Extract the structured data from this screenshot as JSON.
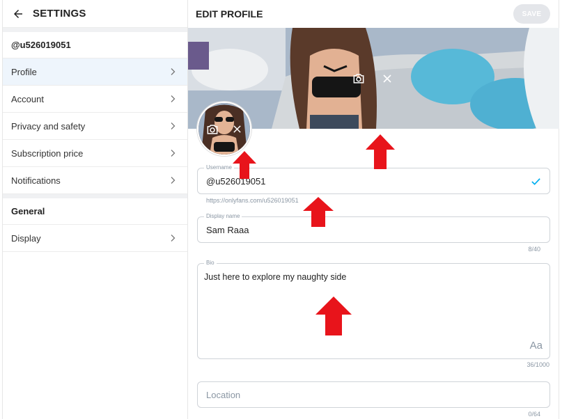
{
  "sidebar": {
    "title": "SETTINGS",
    "username": "@u526019051",
    "items": [
      {
        "label": "Profile"
      },
      {
        "label": "Account"
      },
      {
        "label": "Privacy and safety"
      },
      {
        "label": "Subscription price"
      },
      {
        "label": "Notifications"
      }
    ],
    "general_heading": "General",
    "general_items": [
      {
        "label": "Display"
      }
    ]
  },
  "main": {
    "title": "EDIT PROFILE",
    "save_label": "SAVE",
    "username": {
      "label": "Username",
      "value": "@u526019051",
      "hint": "https://onlyfans.com/u526019051"
    },
    "display_name": {
      "label": "Display name",
      "value": "Sam Raaa",
      "counter": "8/40"
    },
    "bio": {
      "label": "Bio",
      "value": "Just here to explore my naughty side",
      "counter": "36/1000",
      "format_label": "Aa"
    },
    "location": {
      "placeholder": "Location",
      "counter": "0/64"
    }
  },
  "colors": {
    "accent": "#00aff0",
    "annotation_arrow": "#e8141b",
    "active_bg": "#eef5fc"
  }
}
